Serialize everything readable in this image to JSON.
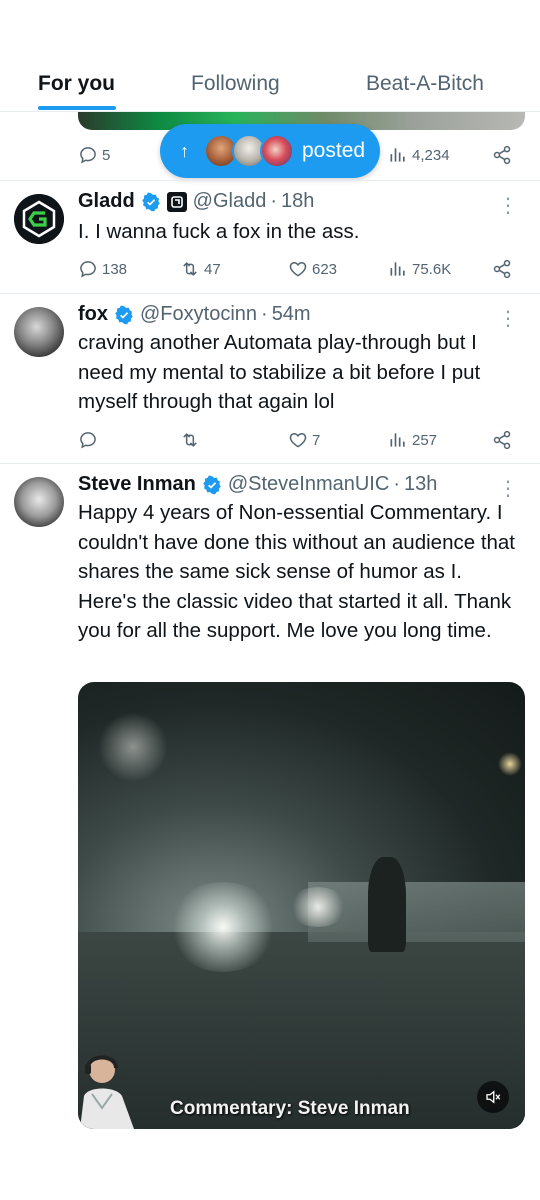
{
  "tabs": [
    {
      "label": "For you",
      "active": true
    },
    {
      "label": "Following",
      "active": false
    },
    {
      "label": "Beat-A-Bitch",
      "active": false
    }
  ],
  "partial_tweet": {
    "replies": "5",
    "views": "4,234"
  },
  "posted_pill": {
    "label": "posted",
    "arrow_icon": "arrow-up-icon"
  },
  "tweets": [
    {
      "name": "Gladd",
      "handle": "@Gladd",
      "time": "18h",
      "text": "I. I wanna fuck a fox in the ass.",
      "replies": "138",
      "reposts": "47",
      "likes": "623",
      "views": "75.6K"
    },
    {
      "name": "fox",
      "handle": "@Foxytocinn",
      "time": "54m",
      "text": "craving another Automata play-through but I need my mental to stabilize a bit before I put myself through that again lol",
      "replies": "",
      "reposts": "",
      "likes": "7",
      "views": "257"
    },
    {
      "name": "Steve Inman",
      "handle": "@SteveInmanUIC",
      "time": "13h",
      "text": "Happy 4 years of Non-essential Commentary. I couldn't have done this without an audience that shares the same sick sense of humor as I. Here's the classic video that started it all. Thank you for all the support. Me love you long time.",
      "video_caption": "Commentary: Steve Inman"
    }
  ],
  "colors": {
    "accent": "#1d9bf0",
    "text": "#0f1419",
    "muted": "#536471",
    "border": "#e6ecf0"
  }
}
